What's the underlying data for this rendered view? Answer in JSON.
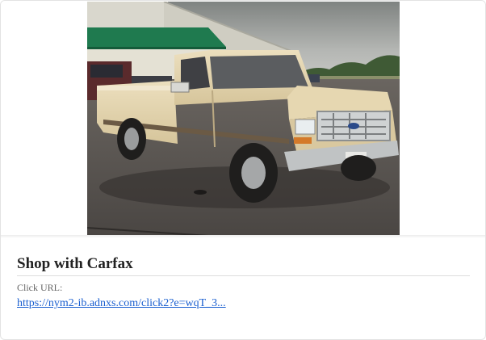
{
  "ad": {
    "image_alt": "Tan pickup truck parked in lot",
    "title": "Shop with Carfax",
    "click_url_label": "Click URL:",
    "click_url": "https://nym2-ib.adnxs.com/click2?e=wqT_3..."
  },
  "colors": {
    "link": "#1a5fd0",
    "title": "#222222",
    "label": "#666666",
    "truck_body": "#e3d3ad",
    "sky": "#a8aba9",
    "building_roof": "#1f7a4f",
    "asphalt": "#56524f"
  }
}
